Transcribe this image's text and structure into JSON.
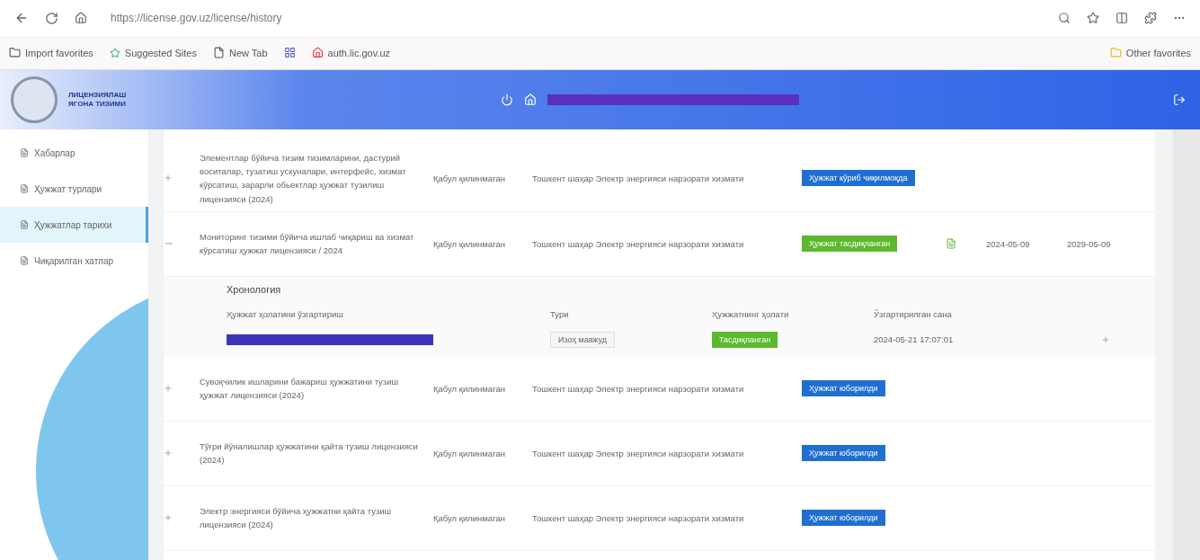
{
  "browser": {
    "url": "https://license.gov.uz/license/history",
    "favorites": [
      {
        "label": "Import favorites",
        "kind": "import"
      },
      {
        "label": "Suggested Sites",
        "kind": "sites"
      },
      {
        "label": "New Tab",
        "kind": "page"
      },
      {
        "kind": "teams"
      },
      {
        "label": "auth.lic.gov.uz",
        "kind": "gov"
      }
    ],
    "other_favorites": "Other favorites"
  },
  "header": {
    "logo_lines": [
      "ЛИЦЕНЗИЯЛАШ",
      "ЯГОНА ТИЗИМИ"
    ]
  },
  "sidebar": {
    "items": [
      {
        "label": "Хабарлар",
        "selected": false
      },
      {
        "label": "Ҳужжат турлари",
        "selected": false
      },
      {
        "label": "Ҳужжатлар тарихи",
        "selected": true
      },
      {
        "label": "Чиқарилган хатлар",
        "selected": false
      }
    ]
  },
  "rows": [
    {
      "name": "Элементлар бўйича тизим тизимларини, дастурий воситалар, тузатиш ускуналари, интерфейс, хизмат кўрсатиш, зарарли обьектлар ҳужжат тузилиш лицензияси (2024)",
      "expanded": false,
      "type": "Қабул қилинмаган",
      "organization": "Тошкент шаҳар Электр энергияси нарзорати хизмати",
      "status": {
        "label": "Ҳужжат кўриб чиқилмоқда",
        "kind": "pending"
      }
    },
    {
      "name": "Мониторинг тизими бўйича ишлаб чиқариш ва хизмат кўрсатиш ҳужжат лицензияси / 2024",
      "expanded": true,
      "type": "Қабул қилинмаган",
      "organization": "Тошкент шаҳар Электр энергияси нарзорати хизмати",
      "status": {
        "label": "Ҳужжат тасдиқланган",
        "kind": "approved"
      },
      "issued": "2024-05-09",
      "expires": "2029-05-09",
      "history": {
        "title": "Хронология",
        "columns": [
          "Ҳужжат ҳолатини ўзгартириш",
          "Тури",
          "Ҳужжатнинг ҳолати",
          "Ўзгартирилган сана"
        ],
        "entry": {
          "type": "Изоҳ мавжуд",
          "status": "Тасдиқланган",
          "date": "2024-05-21 17:07:01"
        }
      }
    },
    {
      "name": "Сувоқчилик ишларини бажариш ҳужжатини тузиш ҳужжат лицензияси (2024)",
      "expanded": false,
      "type": "Қабул қилинмаган",
      "organization": "Тошкент шаҳар Электр энергияси нарзорати хизмати",
      "status": {
        "label": "Ҳужжат юборилди",
        "kind": "sent"
      }
    },
    {
      "name": "Тўғри йўналишлар ҳужжатини қайта тузиш лицензияси (2024)",
      "expanded": false,
      "type": "Қабул қилинмаган",
      "organization": "Тошкент шаҳар Электр энергияси нарзорати хизмати",
      "status": {
        "label": "Ҳужжат юборилди",
        "kind": "sent"
      }
    },
    {
      "name": "Электр энергияси бўйича ҳужжатни қайта тузиш лицензияси (2024)",
      "expanded": false,
      "type": "Қабул қилинмаган",
      "organization": "Тошкент шаҳар Электр энергияси нарзорати хизмати",
      "status": {
        "label": "Ҳужжат юборилди",
        "kind": "sent"
      }
    }
  ]
}
